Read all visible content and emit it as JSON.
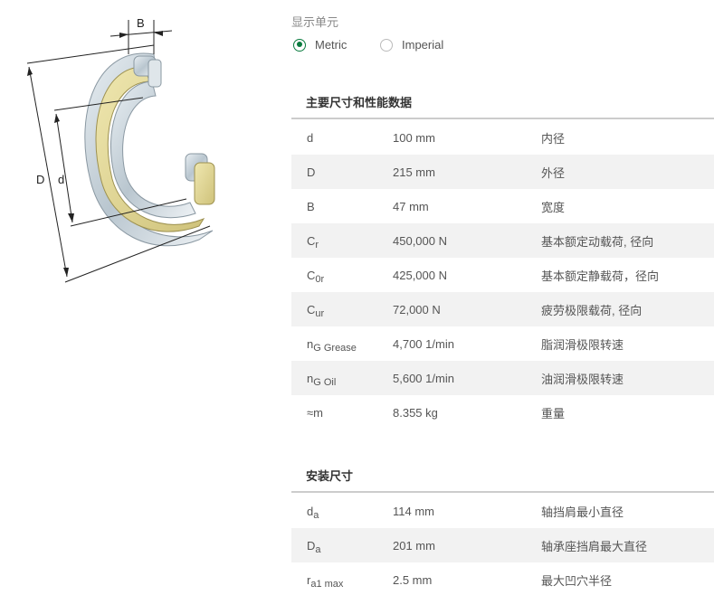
{
  "diagram": {
    "label_B": "B",
    "label_D": "D",
    "label_d": "d"
  },
  "units": {
    "label": "显示单元",
    "options": [
      {
        "label": "Metric",
        "checked": true
      },
      {
        "label": "Imperial",
        "checked": false
      }
    ]
  },
  "main": {
    "title": "主要尺寸和性能数据",
    "rows": [
      {
        "sym": "d",
        "sub": "",
        "value": "100 mm",
        "desc": "内径"
      },
      {
        "sym": "D",
        "sub": "",
        "value": "215 mm",
        "desc": "外径"
      },
      {
        "sym": "B",
        "sub": "",
        "value": "47 mm",
        "desc": "宽度"
      },
      {
        "sym": "C",
        "sub": "r",
        "value": "450,000 N",
        "desc": "基本额定动载荷, 径向"
      },
      {
        "sym": "C",
        "sub": "0r",
        "value": "425,000 N",
        "desc": "基本额定静载荷，径向"
      },
      {
        "sym": "C",
        "sub": "ur",
        "value": "72,000 N",
        "desc": "疲劳极限载荷, 径向"
      },
      {
        "sym": "n",
        "sub": "G Grease",
        "value": "4,700 1/min",
        "desc": "脂润滑极限转速"
      },
      {
        "sym": "n",
        "sub": "G Oil",
        "value": "5,600 1/min",
        "desc": "油润滑极限转速"
      },
      {
        "sym": "≈m",
        "sub": "",
        "value": "8.355 kg",
        "desc": "重量"
      }
    ]
  },
  "mounting": {
    "title": "安装尺寸",
    "rows": [
      {
        "sym": "d",
        "sub": "a",
        "value": "114 mm",
        "desc": "轴挡肩最小直径"
      },
      {
        "sym": "D",
        "sub": "a",
        "value": "201 mm",
        "desc": "轴承座挡肩最大直径"
      },
      {
        "sym": "r",
        "sub": "a1 max",
        "value": "2.5 mm",
        "desc": "最大凹穴半径"
      }
    ]
  }
}
